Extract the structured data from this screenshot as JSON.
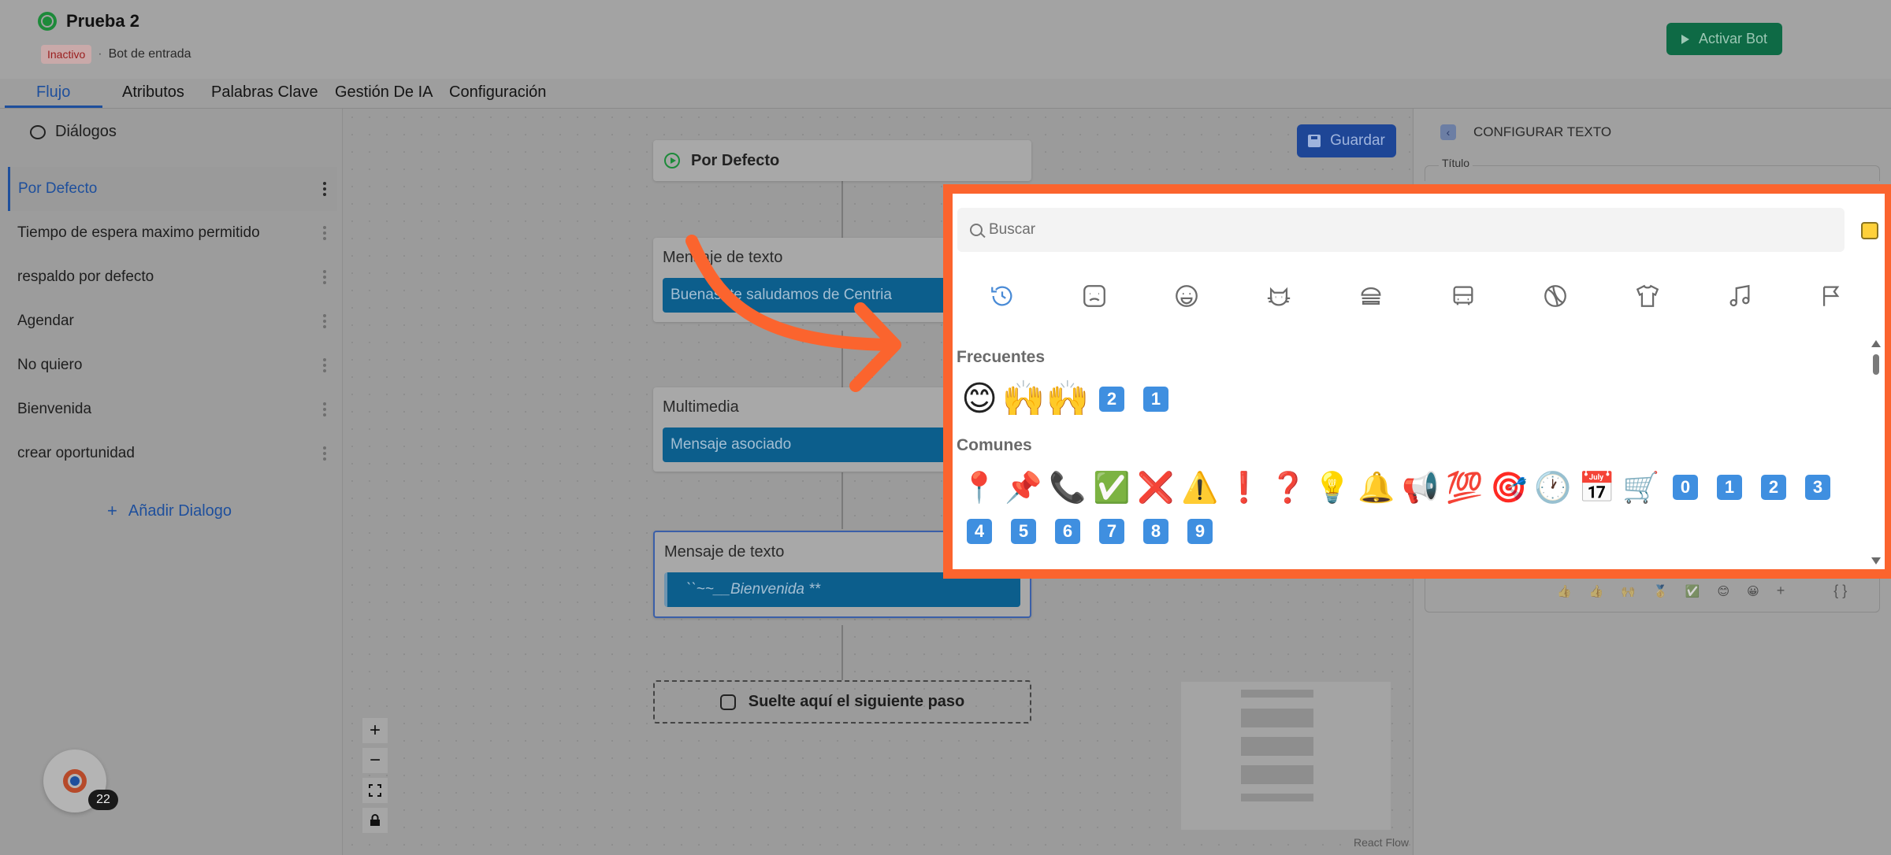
{
  "header": {
    "bot_name": "Prueba 2",
    "status": "Inactivo",
    "separator": "·",
    "bot_type": "Bot de entrada",
    "activate_label": "Activar Bot"
  },
  "tabs": [
    {
      "label": "Flujo",
      "active": true
    },
    {
      "label": "Atributos"
    },
    {
      "label": "Palabras Clave"
    },
    {
      "label": "Gestión De IA"
    },
    {
      "label": "Configuración"
    }
  ],
  "sidebar": {
    "title": "Diálogos",
    "items": [
      {
        "label": "Por Defecto",
        "active": true
      },
      {
        "label": "Tiempo de espera maximo permitido"
      },
      {
        "label": "respaldo por defecto"
      },
      {
        "label": "Agendar"
      },
      {
        "label": "No quiero"
      },
      {
        "label": "Bienvenida"
      },
      {
        "label": "crear oportunidad"
      }
    ],
    "add_label": "Añadir Dialogo"
  },
  "canvas": {
    "save_label": "Guardar",
    "start_node": "Por Defecto",
    "nodes": [
      {
        "title": "Mensaje de texto",
        "content": "Buenas, te saludamos de Centria"
      },
      {
        "title": "Multimedia",
        "content": "Mensaje asociado"
      },
      {
        "title": "Mensaje de texto",
        "content": "``~~__Bienvenida **"
      }
    ],
    "drop_label": "Suelte aquí el siguiente paso",
    "zoom_in": "+",
    "zoom_out": "−",
    "watermark": "React Flow"
  },
  "right_panel": {
    "title": "CONFIGURAR TEXTO",
    "field_label": "Título",
    "toolbar_emojis": [
      "👍",
      "👍",
      "🙌",
      "🥇",
      "✅",
      "😊",
      "😀"
    ],
    "toolbar_plus": "+",
    "toolbar_var": "{ }"
  },
  "launcher": {
    "badge": "22"
  },
  "emoji_picker": {
    "search_placeholder": "Buscar",
    "categories": [
      "recent",
      "smileys",
      "people",
      "animals",
      "food",
      "travel",
      "activities",
      "objects",
      "symbols",
      "flags"
    ],
    "sections": [
      {
        "title": "Frecuentes",
        "emojis": [
          "😊",
          "🙌",
          "🙌"
        ],
        "keys": [
          "2",
          "1"
        ]
      },
      {
        "title": "Comunes",
        "row1": [
          "📍",
          "📌",
          "📞",
          "✅",
          "❌",
          "⚠️",
          "❗",
          "❓",
          "💡",
          "🔔",
          "📢",
          "💯",
          "🎯",
          "🕐",
          "📅",
          "🛒"
        ],
        "row1_keys": [
          "0",
          "1",
          "2",
          "3"
        ],
        "row2_keys": [
          "4",
          "5",
          "6",
          "7",
          "8",
          "9"
        ]
      }
    ]
  },
  "colors": {
    "highlight_frame": "#fb642e",
    "accent": "#1e4f9c",
    "node_fill": "#0c5e8c",
    "activate_button": "#0e6a45"
  }
}
